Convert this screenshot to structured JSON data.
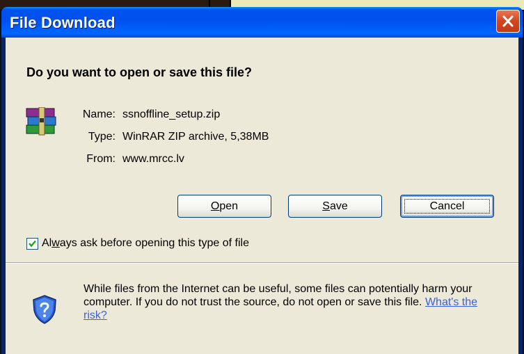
{
  "window": {
    "title": "File Download"
  },
  "dialog": {
    "question": "Do you want to open or save this file?",
    "file": {
      "icon": "winrar-archive-icon",
      "name_label": "Name:",
      "name_value": "ssnoffline_setup.zip",
      "type_label": "Type:",
      "type_value": "WinRAR ZIP archive, 5,38MB",
      "from_label": "From:",
      "from_value": "www.mrcc.lv"
    },
    "buttons": {
      "open_mnemonic": "O",
      "open_rest": "pen",
      "save_mnemonic": "S",
      "save_rest": "ave",
      "cancel": "Cancel"
    },
    "checkbox": {
      "checked": true,
      "label_pre": "Al",
      "label_mnemonic": "w",
      "label_post": "ays ask before opening this type of file"
    },
    "warning": {
      "icon": "security-shield-question-icon",
      "text": "While files from the Internet can be useful, some files can potentially harm your computer. If you do not trust the source, do not open or save this file.",
      "link": "What's the risk?"
    }
  },
  "colors": {
    "titlebar": "#0054e3",
    "client": "#ece9d8",
    "close": "#d2451f",
    "link": "#3a5fd8"
  }
}
